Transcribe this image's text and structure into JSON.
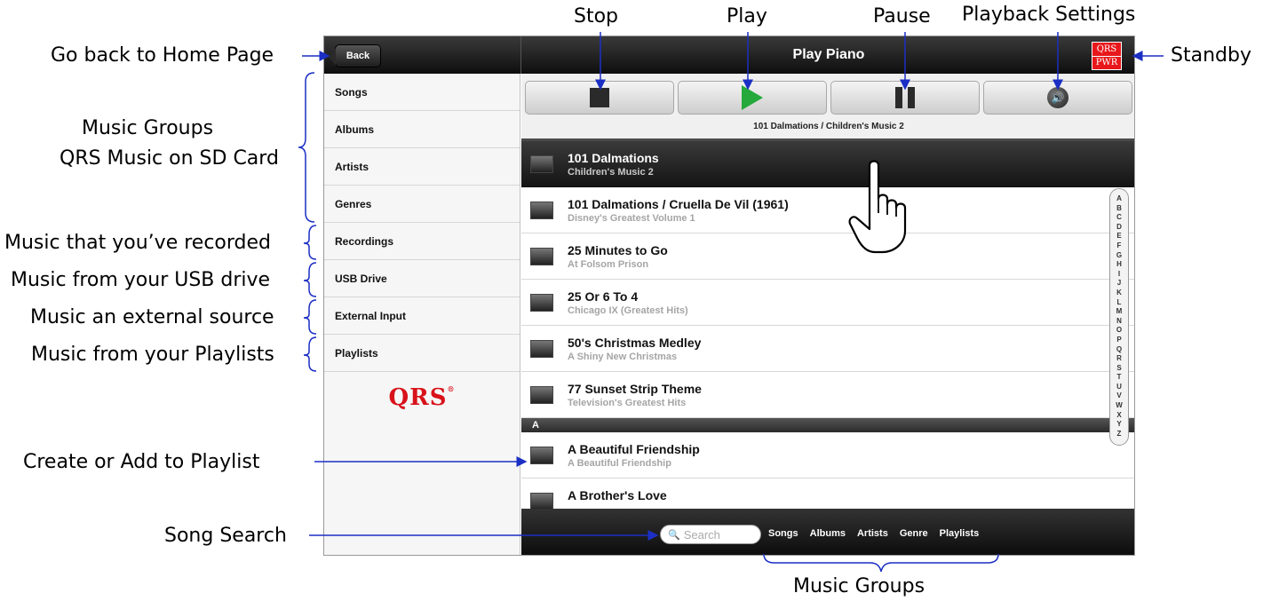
{
  "annotations": {
    "stop": "Stop",
    "play": "Play",
    "pause": "Pause",
    "playback_settings": "Playback Settings",
    "back_home": "Go back to Home Page",
    "standby": "Standby",
    "music_groups_1": "Music Groups",
    "music_groups_2": "QRS Music on SD Card",
    "recorded": "Music that you’ve recorded",
    "usb": "Music from your USB drive",
    "external": "Music an external source",
    "playlists": "Music from your Playlists",
    "create_playlist": "Create or Add to Playlist",
    "song_search": "Song Search",
    "music_groups_bottom": "Music Groups"
  },
  "topbar": {
    "back_label": "Back",
    "title": "Play Piano",
    "power_line1": "QRS",
    "power_line2": "PWR"
  },
  "sidebar": {
    "items": [
      {
        "label": "Songs"
      },
      {
        "label": "Albums"
      },
      {
        "label": "Artists"
      },
      {
        "label": "Genres"
      },
      {
        "label": "Recordings"
      },
      {
        "label": "USB Drive"
      },
      {
        "label": "External Input"
      },
      {
        "label": "Playlists"
      }
    ],
    "logo": "QRS"
  },
  "transport": {
    "now_playing": "101 Dalmations / Children's Music 2",
    "icons": [
      "stop-icon",
      "play-icon",
      "pause-icon",
      "speaker-icon"
    ]
  },
  "songs": [
    {
      "title": "101 Dalmations",
      "sub": "Children's Music 2"
    },
    {
      "title": "101 Dalmations / Cruella De Vil (1961)",
      "sub": "Disney's Greatest Volume 1"
    },
    {
      "title": "25 Minutes to Go",
      "sub": "At Folsom Prison"
    },
    {
      "title": "25 Or 6 To 4",
      "sub": "Chicago IX (Greatest Hits)"
    },
    {
      "title": "50's Christmas Medley",
      "sub": "A Shiny New Christmas"
    },
    {
      "title": "77 Sunset Strip Theme",
      "sub": "Television's Greatest Hits"
    }
  ],
  "section_a": "A",
  "songs_a": [
    {
      "title": "A Beautiful Friendship",
      "sub": "A Beautiful Friendship"
    },
    {
      "title": "A Brother's Love",
      "sub": ""
    }
  ],
  "alpha": [
    "A",
    "B",
    "C",
    "D",
    "E",
    "F",
    "G",
    "H",
    "I",
    "J",
    "K",
    "L",
    "M",
    "N",
    "O",
    "P",
    "Q",
    "R",
    "S",
    "T",
    "U",
    "V",
    "W",
    "X",
    "Y",
    "Z"
  ],
  "bottombar": {
    "search_placeholder": "Search",
    "tabs": [
      "Songs",
      "Albums",
      "Artists",
      "Genre",
      "Playlists"
    ]
  },
  "colors": {
    "accent_red": "#e8171b",
    "play_green": "#24a93a",
    "callout_blue": "#1c2fc4"
  }
}
